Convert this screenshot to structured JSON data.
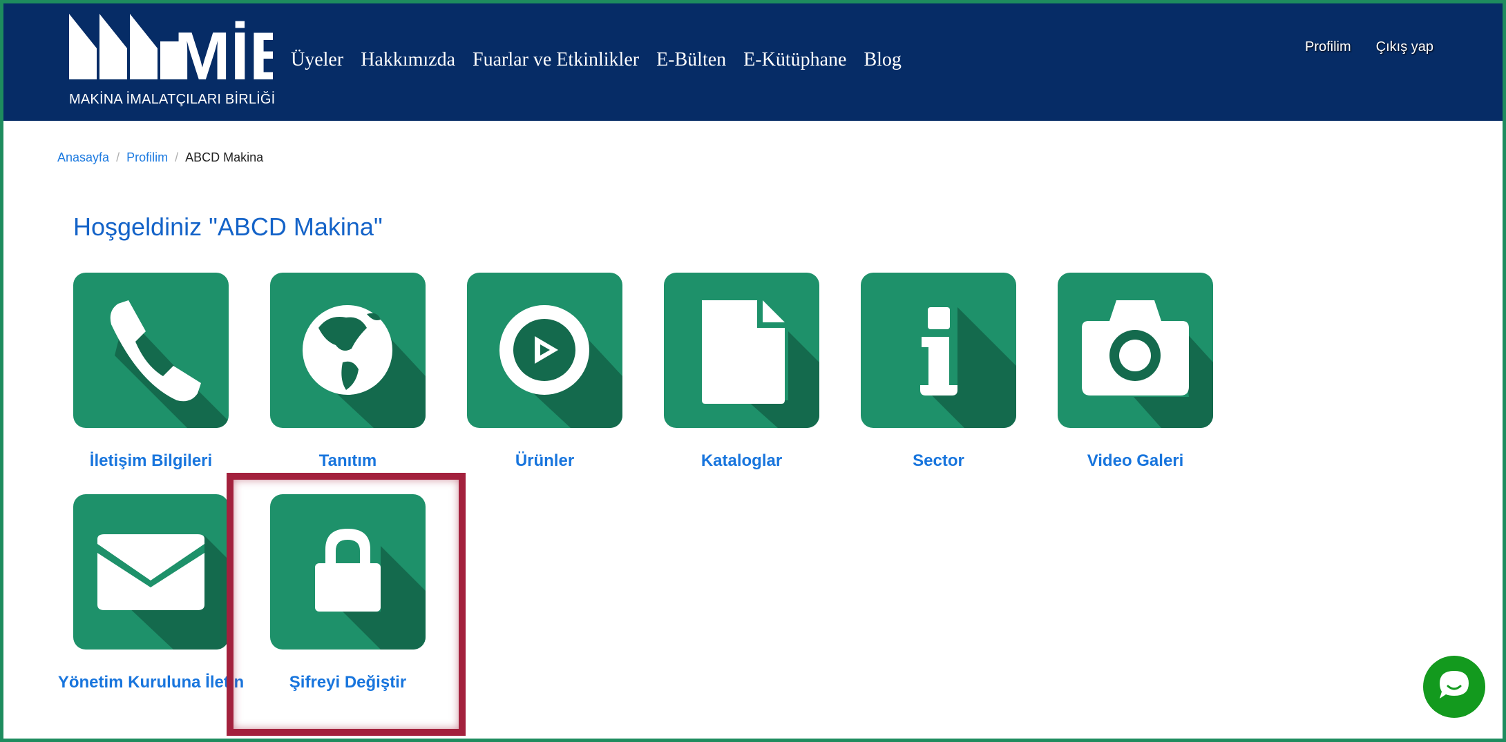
{
  "header": {
    "logo_text": "MİB",
    "logo_subtitle": "MAKİNA İMALATÇILARI BİRLİĞİ",
    "nav": [
      "Üyeler",
      "Hakkımızda",
      "Fuarlar ve Etkinlikler",
      "E-Bülten",
      "E-Kütüphane",
      "Blog"
    ],
    "user_links": {
      "profile": "Profilim",
      "logout": "Çıkış yap"
    }
  },
  "breadcrumb": [
    "Anasayfa",
    "Profilim",
    "ABCD Makina"
  ],
  "welcome_title": "Hoşgeldiniz \"ABCD Makina\"",
  "tiles": [
    {
      "icon": "phone-icon",
      "label": "İletişim Bilgileri"
    },
    {
      "icon": "globe-icon",
      "label": "Tanıtım"
    },
    {
      "icon": "play-circle-icon",
      "label": "Ürünler"
    },
    {
      "icon": "document-icon",
      "label": "Kataloglar"
    },
    {
      "icon": "info-icon",
      "label": "Sector"
    },
    {
      "icon": "camera-icon",
      "label": "Video Galeri"
    },
    {
      "icon": "envelope-icon",
      "label": "Yönetim Kuruluna İletin"
    },
    {
      "icon": "lock-icon",
      "label": "Şifreyi Değiştir"
    }
  ],
  "colors": {
    "header_bg": "#062c66",
    "tile_bg": "#1e916a",
    "tile_shadow": "#146a4d",
    "link": "#1875dd",
    "highlight": "#a3213d",
    "chat": "#139a1e"
  },
  "highlighted_tile": "Şifreyi Değiştir"
}
